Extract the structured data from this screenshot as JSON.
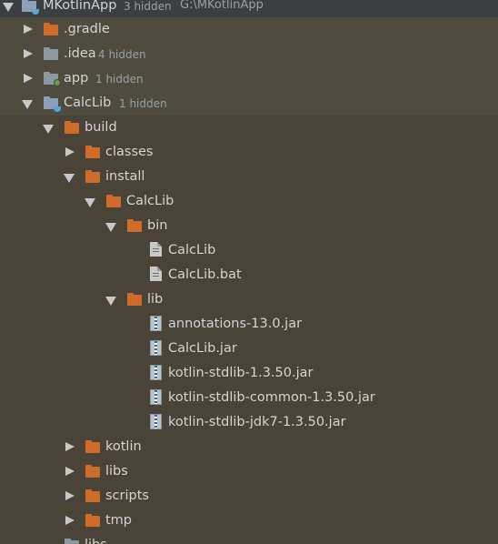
{
  "project": {
    "name": "MKotlinApp",
    "hidden": "3 hidden",
    "path": "G:\\MKotlinApp"
  },
  "items": {
    "gradle": ".gradle",
    "idea": ".idea",
    "idea_hidden": "4 hidden",
    "app": "app",
    "app_hidden": "1 hidden",
    "calclib": "CalcLib",
    "calclib_hidden": "1 hidden",
    "build": "build",
    "classes": "classes",
    "install": "install",
    "install_calclib": "CalcLib",
    "bin": "bin",
    "bin_calclib": "CalcLib",
    "bin_calclib_bat": "CalcLib.bat",
    "lib": "lib",
    "jar1": "annotations-13.0.jar",
    "jar2": "CalcLib.jar",
    "jar3": "kotlin-stdlib-1.3.50.jar",
    "jar4": "kotlin-stdlib-common-1.3.50.jar",
    "jar5": "kotlin-stdlib-jdk7-1.3.50.jar",
    "kotlin": "kotlin",
    "libs": "libs",
    "scripts": "scripts",
    "tmp": "tmp",
    "libs_bottom": "libs"
  },
  "icons": {
    "folder_color": "#d06c2a",
    "gray_folder_color": "#8e98a1",
    "module_folder_color": "#8ca1b8",
    "background": "#494437"
  }
}
